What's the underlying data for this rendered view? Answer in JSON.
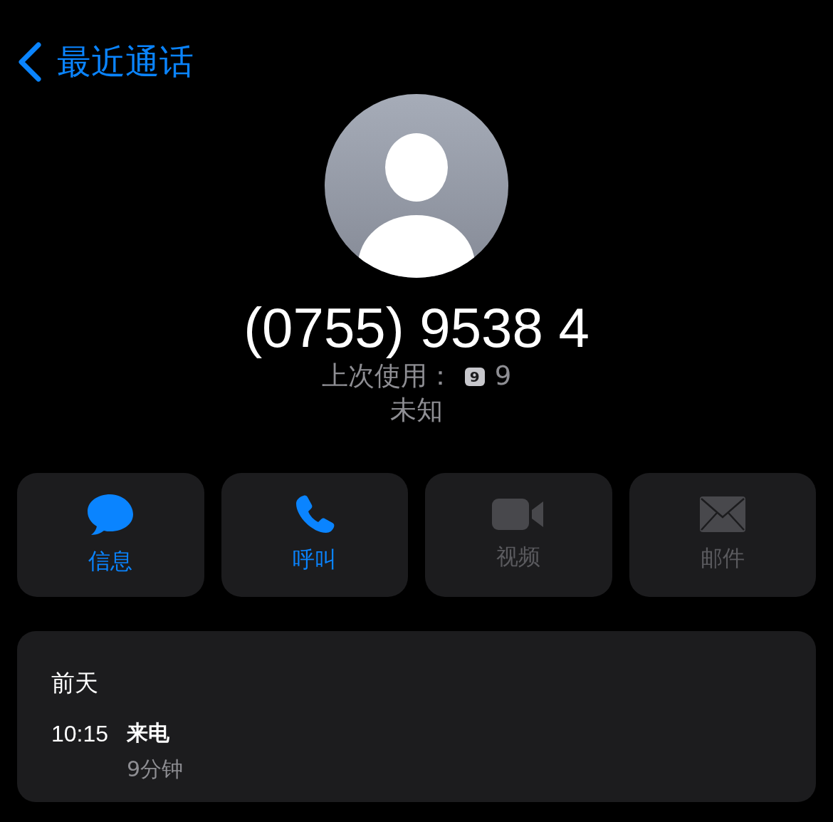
{
  "back": {
    "label": "最近通话"
  },
  "contact": {
    "number": "(0755) 9538 4",
    "last_used_label": "上次使用：",
    "sim_badge": "9",
    "sim_name": "9",
    "location": "未知"
  },
  "actions": [
    {
      "label": "信息",
      "kind": "message",
      "disabled": false
    },
    {
      "label": "呼叫",
      "kind": "call",
      "disabled": false
    },
    {
      "label": "视频",
      "kind": "video",
      "disabled": true
    },
    {
      "label": "邮件",
      "kind": "mail",
      "disabled": true
    }
  ],
  "call_history": {
    "date": "前天",
    "entries": [
      {
        "time": "10:15",
        "type": "来电",
        "duration": "9分钟"
      }
    ]
  }
}
